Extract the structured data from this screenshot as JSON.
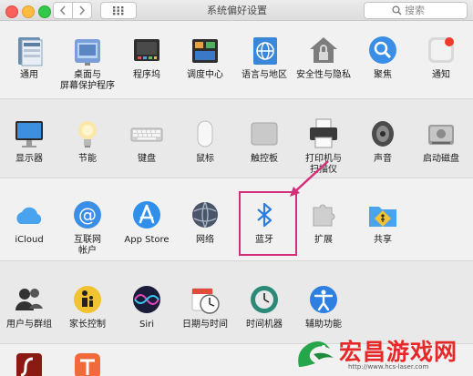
{
  "window": {
    "title": "系统偏好设置"
  },
  "search": {
    "placeholder": "搜索"
  },
  "rows": [
    [
      {
        "label": "通用"
      },
      {
        "label": "桌面与\n屏幕保护程序"
      },
      {
        "label": "程序坞"
      },
      {
        "label": "调度中心"
      },
      {
        "label": "语言与地区"
      },
      {
        "label": "安全性与隐私"
      },
      {
        "label": "聚焦"
      },
      {
        "label": "通知"
      }
    ],
    [
      {
        "label": "显示器"
      },
      {
        "label": "节能"
      },
      {
        "label": "键盘"
      },
      {
        "label": "鼠标"
      },
      {
        "label": "触控板"
      },
      {
        "label": "打印机与\n扫描仪"
      },
      {
        "label": "声音"
      },
      {
        "label": "启动磁盘"
      }
    ],
    [
      {
        "label": "iCloud"
      },
      {
        "label": "互联网\n帐户"
      },
      {
        "label": "App Store"
      },
      {
        "label": "网络"
      },
      {
        "label": "蓝牙"
      },
      {
        "label": "扩展"
      },
      {
        "label": "共享"
      }
    ],
    [
      {
        "label": "用户与群组"
      },
      {
        "label": "家长控制"
      },
      {
        "label": "Siri"
      },
      {
        "label": "日期与时间"
      },
      {
        "label": "时间机器"
      },
      {
        "label": "辅助功能"
      }
    ]
  ],
  "watermark": {
    "text": "宏昌游戏网",
    "url": "http://www.hcs-laser.com"
  }
}
